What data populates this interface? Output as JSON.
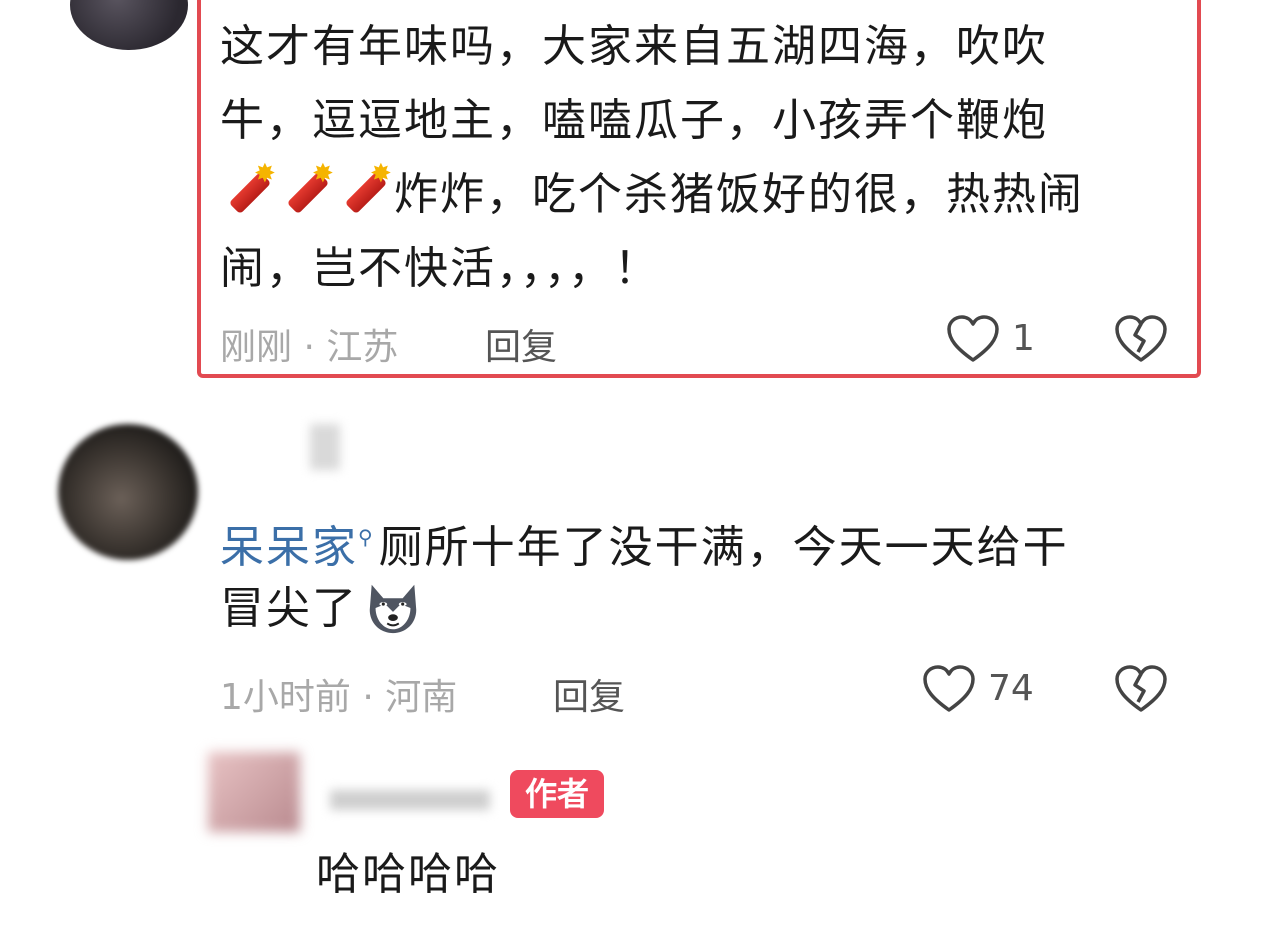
{
  "comments": [
    {
      "text_lines": [
        "这才有年味吗，大家来自五湖四海，吹吹",
        "牛，逗逗地主，嗑嗑瓜子，小孩弄个鞭炮",
        "炸炸，吃个杀猪饭好的很，热热闹",
        "闹，岂不快活，，，，！"
      ],
      "emoji_icon": "firecracker-icon",
      "time": "刚刚",
      "location": "江苏",
      "meta": "刚刚 · 江苏",
      "reply_label": "回复",
      "likes": "1",
      "highlight_color": "#e24a51"
    },
    {
      "keyword": "呆呆家",
      "text_line1_rest": "厕所十年了没干满，今天一天给干",
      "text_line2": "冒尖了",
      "emoji_icon": "husky-icon",
      "time": "1小时前",
      "location": "河南",
      "meta": "1小时前 · 河南",
      "reply_label": "回复",
      "likes": "74",
      "keyword_color": "#3b6fa8"
    }
  ],
  "author_reply": {
    "badge": "作者",
    "text": "哈哈哈哈",
    "badge_color": "#ef4a5e"
  }
}
